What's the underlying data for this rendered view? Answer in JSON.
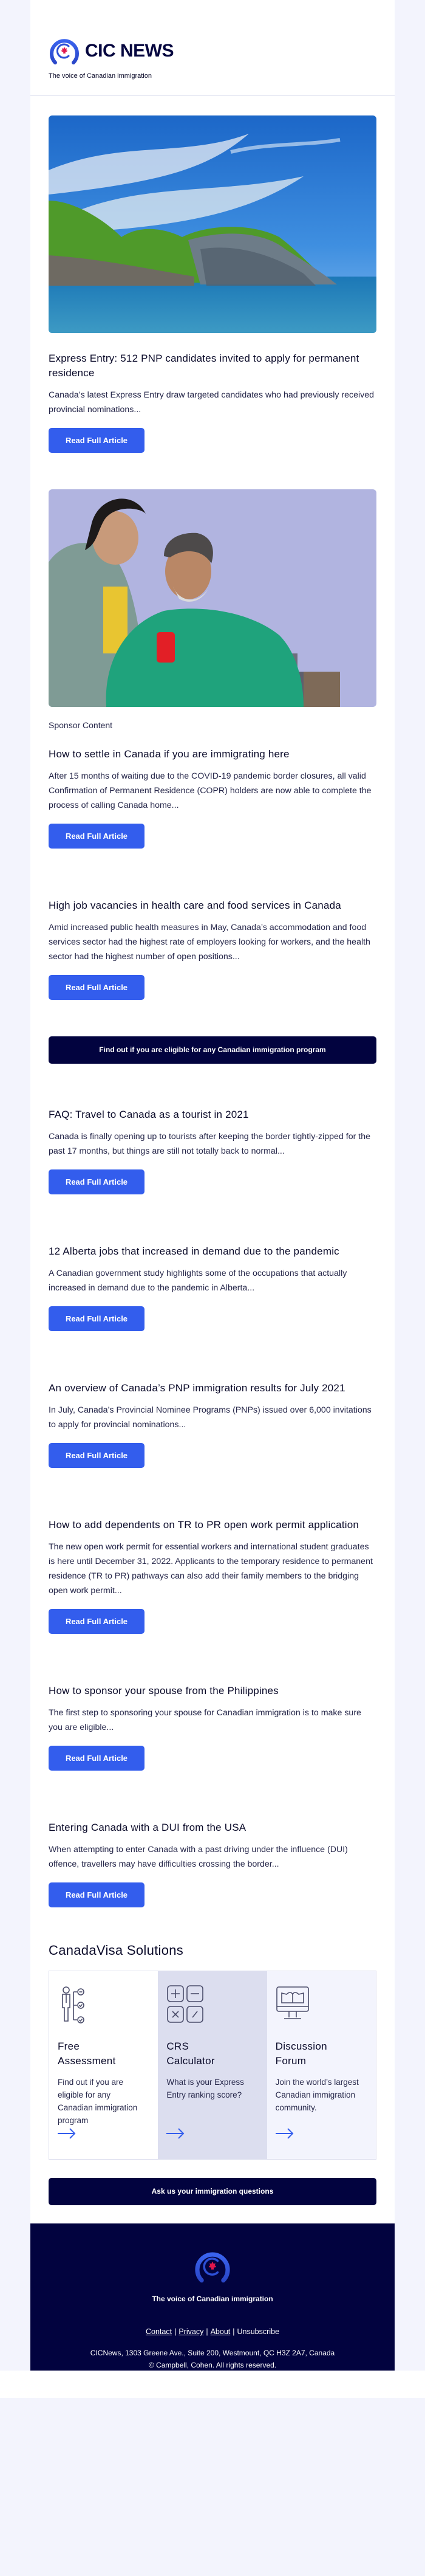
{
  "header": {
    "brand_name": "CIC NEWS",
    "tagline": "The voice of Canadian immigration"
  },
  "colors": {
    "accent_blue": "#335ded",
    "navy": "#02033f",
    "maple_red": "#e0174d",
    "page_bg": "#f3f4fd"
  },
  "articles": [
    {
      "image": "landscape-coastal-cliff-photo",
      "title": "Express Entry: 512 PNP candidates invited to apply for permanent residence",
      "description": "Canada’s latest Express Entry draw targeted candidates who had previously received provincial nominations...",
      "button_label": "Read Full Article"
    },
    {
      "image": "woman-and-man-looking-at-phone-photo",
      "label": "Sponsor Content",
      "title": "How to settle in Canada if you are immigrating here",
      "description": "After 15 months of waiting due to the COVID-19 pandemic border closures, all valid Confirmation of Permanent Residence (COPR) holders are now able to complete the process of calling Canada home...",
      "button_label": "Read Full Article"
    },
    {
      "title": "High job vacancies in health care and food services in Canada",
      "description": "Amid increased public health measures in May, Canada’s accommodation and food services sector had the highest rate of employers looking for workers, and the health sector had the highest number of open positions...",
      "button_label": "Read Full Article"
    },
    {
      "title": "FAQ: Travel to Canada as a tourist in 2021",
      "description": "Canada is finally opening up to tourists after keeping the border tightly-zipped for the past 17 months, but things are still not totally back to normal...",
      "button_label": "Read Full Article"
    },
    {
      "title": "12 Alberta jobs that increased in demand due to the pandemic",
      "description": "A Canadian government study highlights some of the occupations that actually increased in demand due to the pandemic in Alberta...",
      "button_label": "Read Full Article"
    },
    {
      "title": "An overview of Canada’s PNP immigration results for July 2021",
      "description": "In July, Canada’s Provincial Nominee Programs (PNPs) issued over 6,000 invitations to apply for provincial nominations...",
      "button_label": "Read Full Article"
    },
    {
      "title": "How to add dependents on TR to PR open work permit application",
      "description": "The new open work permit for essential workers and international student graduates is here until December 31, 2022. Applicants to the temporary residence to permanent residence (TR to PR) pathways can also add their family members to the bridging open work permit...",
      "button_label": "Read Full Article"
    },
    {
      "title": "How to sponsor your spouse from the Philippines",
      "description": "The first step to sponsoring your spouse for Canadian immigration is to make sure you are eligible...",
      "button_label": "Read Full Article"
    },
    {
      "title": "Entering Canada with a DUI from the USA",
      "description": "When attempting to enter Canada with a past driving under the influence (DUI) offence, travellers may have difficulties crossing the border...",
      "button_label": "Read Full Article"
    }
  ],
  "eligibility_cta": "Find out if you are eligible for any Canadian immigration program",
  "solutions": {
    "heading": "CanadaVisa Solutions",
    "cards": [
      {
        "icon": "assessment-checklist-icon",
        "title": "Free Assessment",
        "description": "Find out if you are eligible for any Canadian immigration program"
      },
      {
        "icon": "calculator-icon",
        "title": "CRS Calculator",
        "description": "What is your Express Entry ranking score?"
      },
      {
        "icon": "forum-monitor-book-icon",
        "title": "Discussion Forum",
        "description": "Join the world’s largest Canadian immigration community."
      }
    ]
  },
  "ask_cta": "Ask us your immigration questions",
  "footer": {
    "tagline": "The voice of Canadian immigration",
    "links": [
      "Contact",
      "Privacy",
      "About",
      "Unsubscribe"
    ],
    "separator": "|",
    "address": "CICNews, 1303 Greene Ave., Suite 200, Westmount, QC H3Z 2A7, Canada",
    "copyright": "© Campbell, Cohen. All rights reserved."
  }
}
